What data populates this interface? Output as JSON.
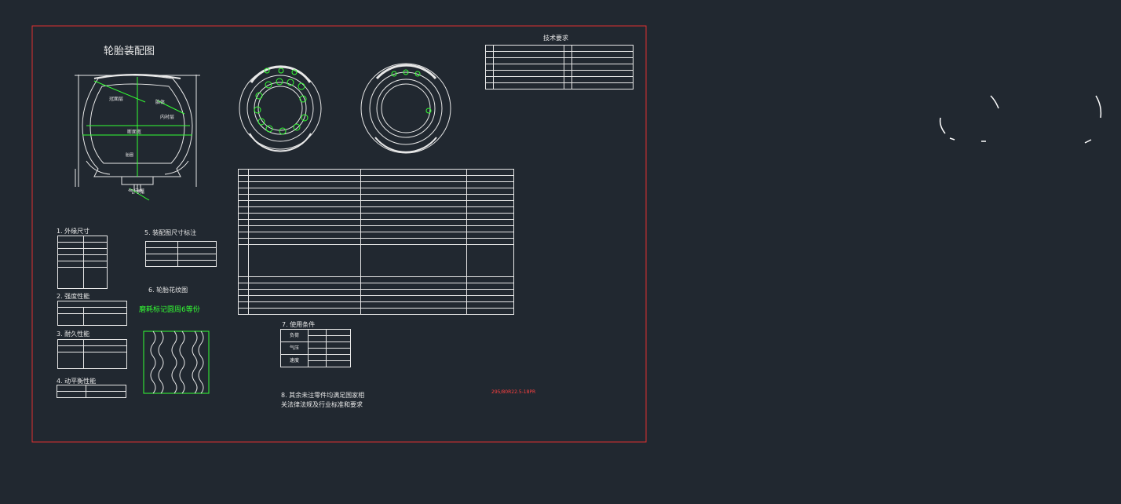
{
  "drawing": {
    "title": "轮胎装配图",
    "tech_requirements_title": "技术要求",
    "model_code": "295/80R22.5-18PR",
    "note": {
      "line1": "8. 其余未注零件均满足国家相",
      "line2": "关法律法规及行业标准和要求"
    }
  },
  "assembly_labels": {
    "crown": "冠面层",
    "sidewall": "胎体",
    "inner_liner": "内衬层",
    "section": "断面宽",
    "bead": "胎圈",
    "valve": "气门嘴"
  },
  "sections": {
    "outer_dims": "1. 外缘尺寸",
    "strength": "2. 强度性能",
    "endurance": "3. 耐久性能",
    "balance": "4. 动平衡性能",
    "assembly_dims": "5. 装配图尺寸标注",
    "tread": "6. 轮胎花纹图",
    "tread_note": "磨耗标记圆周6等份",
    "usage": "7. 使用条件"
  },
  "usage_table": {
    "load": "负荷",
    "pressure": "气压",
    "speed": "速度"
  },
  "colors": {
    "background": "#212830",
    "frame": "#e03030",
    "line": "#e8e8e8",
    "accent": "#33ff33"
  }
}
